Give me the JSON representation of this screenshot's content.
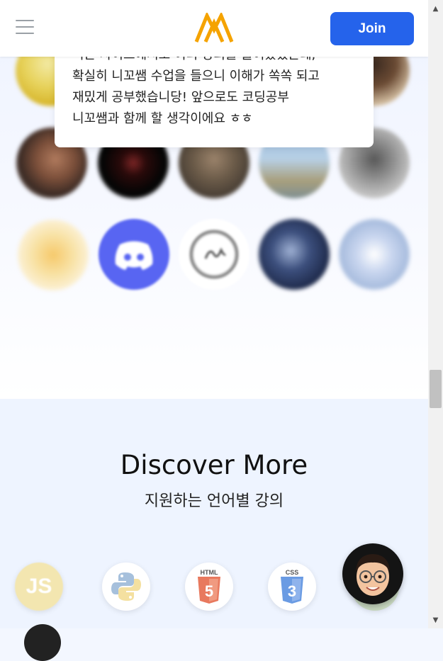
{
  "header": {
    "menu_icon": "hamburger-menu-icon",
    "logo_icon": "brand-logo-icon",
    "join_label": "Join"
  },
  "testimonial": {
    "text": "니는 사이트에서도 여러 강의를 들어왔었는데,\n확실히 니꼬쌤 수업을 들으니 이해가 쏙쏙 되고\n재밌게 공부했습니당! 앞으로도 코딩공부\n니꼬쌤과 함께 할 생각이에요 ㅎㅎ"
  },
  "discover": {
    "title": "Discover More",
    "subtitle": "지원하는 언어별 강의",
    "languages": [
      {
        "name": "JS",
        "icon": "javascript-icon",
        "color": "#f0db4f"
      },
      {
        "name": "Python",
        "icon": "python-icon",
        "color": "#3776ab"
      },
      {
        "name": "HTML",
        "icon": "html5-icon",
        "color": "#e44d26"
      },
      {
        "name": "CSS",
        "icon": "css3-icon",
        "color": "#2965f1"
      }
    ]
  },
  "colors": {
    "accent": "#2563eb",
    "logo": "#f5a300",
    "discord": "#5865f2"
  }
}
